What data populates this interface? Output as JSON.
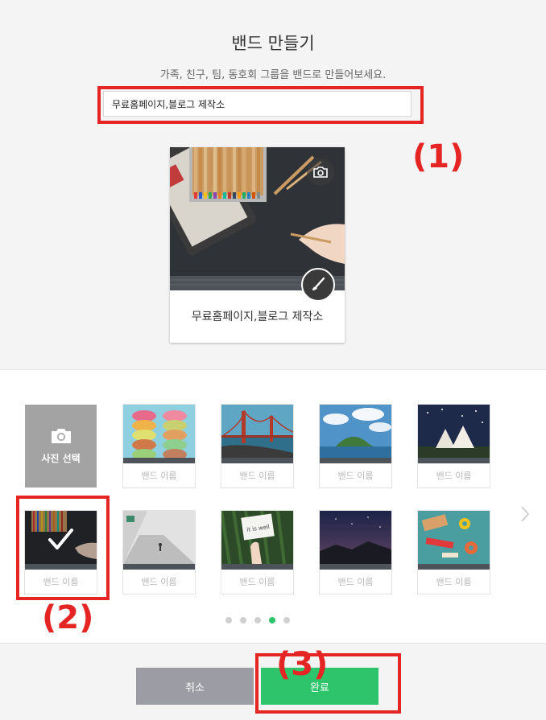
{
  "header": {
    "title": "밴드 만들기",
    "subtitle": "가족, 친구, 팀, 동호회 그룹을 밴드로 만들어보세요."
  },
  "band_name_input": {
    "value": "무료홈페이지,블로그 제작소"
  },
  "preview": {
    "name": "무료홈페이지,블로그 제작소",
    "camera_icon": "camera-icon",
    "edit_icon": "brush-icon"
  },
  "cover_picker": {
    "photo_select_label": "사진 선택",
    "photo_select_icon": "camera-icon",
    "thumb_label": "밴드 이름",
    "thumbs": [
      {
        "label": "밴드 이름",
        "theme": "macarons"
      },
      {
        "label": "밴드 이름",
        "theme": "bridge"
      },
      {
        "label": "밴드 이름",
        "theme": "island"
      },
      {
        "label": "밴드 이름",
        "theme": "tents-night"
      },
      {
        "label": "밴드 이름",
        "theme": "pencils",
        "selected": true
      },
      {
        "label": "밴드 이름",
        "theme": "concrete-steps"
      },
      {
        "label": "밴드 이름",
        "theme": "it-is-well-sign"
      },
      {
        "label": "밴드 이름",
        "theme": "night-sky"
      },
      {
        "label": "밴드 이름",
        "theme": "craft-tools"
      }
    ],
    "pagination": {
      "total": 5,
      "current": 4
    },
    "next_icon": "chevron-right-icon"
  },
  "annotations": {
    "one": "(1)",
    "two": "(2)",
    "three": "(3)"
  },
  "buttons": {
    "cancel": "취소",
    "done": "완료"
  },
  "colors": {
    "accent": "#2ec46b",
    "annotation": "#e52524",
    "cancel": "#9c9ca4"
  }
}
